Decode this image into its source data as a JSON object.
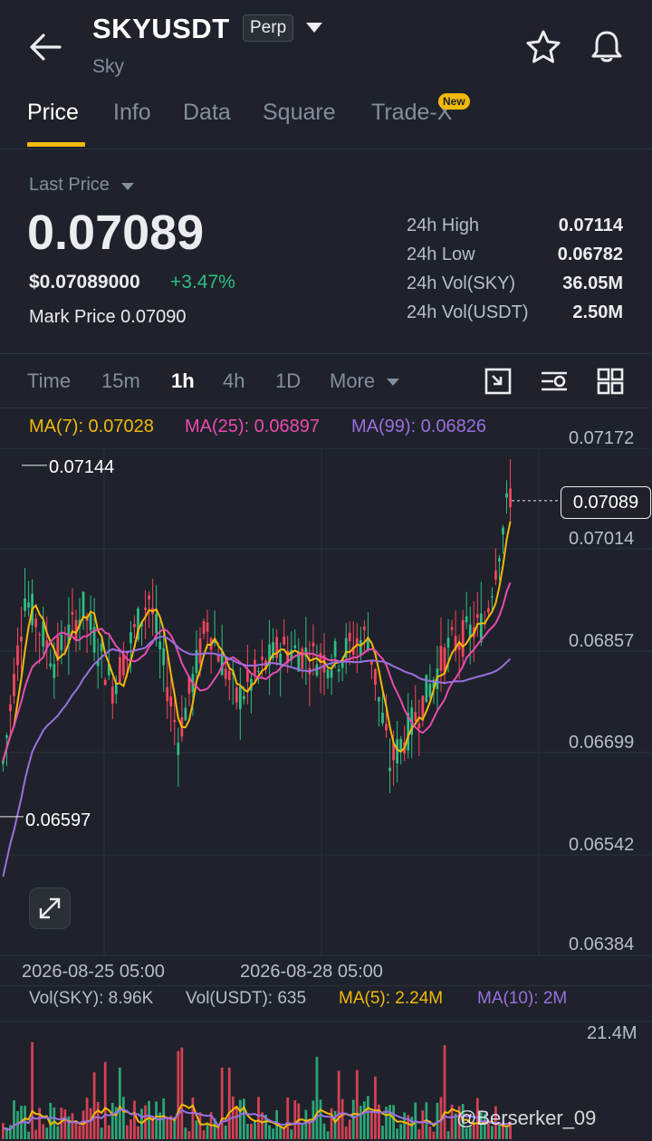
{
  "header": {
    "symbol": "SKYUSDT",
    "contract_badge": "Perp",
    "subtitle": "Sky"
  },
  "tabs": [
    {
      "label": "Price",
      "active": true
    },
    {
      "label": "Info"
    },
    {
      "label": "Data"
    },
    {
      "label": "Square"
    },
    {
      "label": "Trade-X",
      "badge": "New"
    }
  ],
  "price": {
    "label": "Last Price",
    "last": "0.07089",
    "usd": "$0.07089000",
    "change": "+3.47%",
    "mark_label": "Mark Price",
    "mark_value": "0.07090"
  },
  "stats": [
    {
      "label": "24h High",
      "value": "0.07114"
    },
    {
      "label": "24h Low",
      "value": "0.06782"
    },
    {
      "label": "24h Vol(SKY)",
      "value": "36.05M"
    },
    {
      "label": "24h Vol(USDT)",
      "value": "2.50M"
    }
  ],
  "timeframes": [
    {
      "label": "Time"
    },
    {
      "label": "15m"
    },
    {
      "label": "1h",
      "active": true
    },
    {
      "label": "4h"
    },
    {
      "label": "1D"
    },
    {
      "label": "More"
    }
  ],
  "ma_legend": [
    {
      "label": "MA(7): 0.07028",
      "color": "#f0b90b"
    },
    {
      "label": "MA(25): 0.06897",
      "color": "#e84bb0"
    },
    {
      "label": "MA(99): 0.06826",
      "color": "#9b6fe0"
    }
  ],
  "chart_data": {
    "type": "candlestick",
    "y_ticks": [
      "0.07172",
      "0.07014",
      "0.06857",
      "0.06699",
      "0.06542",
      "0.06384"
    ],
    "x_ticks": [
      "2026-08-25 05:00",
      "2026-08-28 05:00"
    ],
    "current_price": "0.07089",
    "high_marker": "0.07144",
    "low_marker": "0.06597",
    "ylim": [
      0.06384,
      0.07172
    ],
    "candle_colors": {
      "up": "#2ebd85",
      "down": "#f6465d"
    },
    "grid": true
  },
  "volume": {
    "legend": [
      {
        "label": "Vol(SKY): 8.96K",
        "color": "#b7bdc6"
      },
      {
        "label": "Vol(USDT): 635",
        "color": "#b7bdc6"
      },
      {
        "label": "MA(5): 2.24M",
        "color": "#f0b90b"
      },
      {
        "label": "MA(10): 2M",
        "color": "#9b6fe0"
      }
    ],
    "y_tick": "21.4M"
  },
  "watermark": "@Berserker_09"
}
